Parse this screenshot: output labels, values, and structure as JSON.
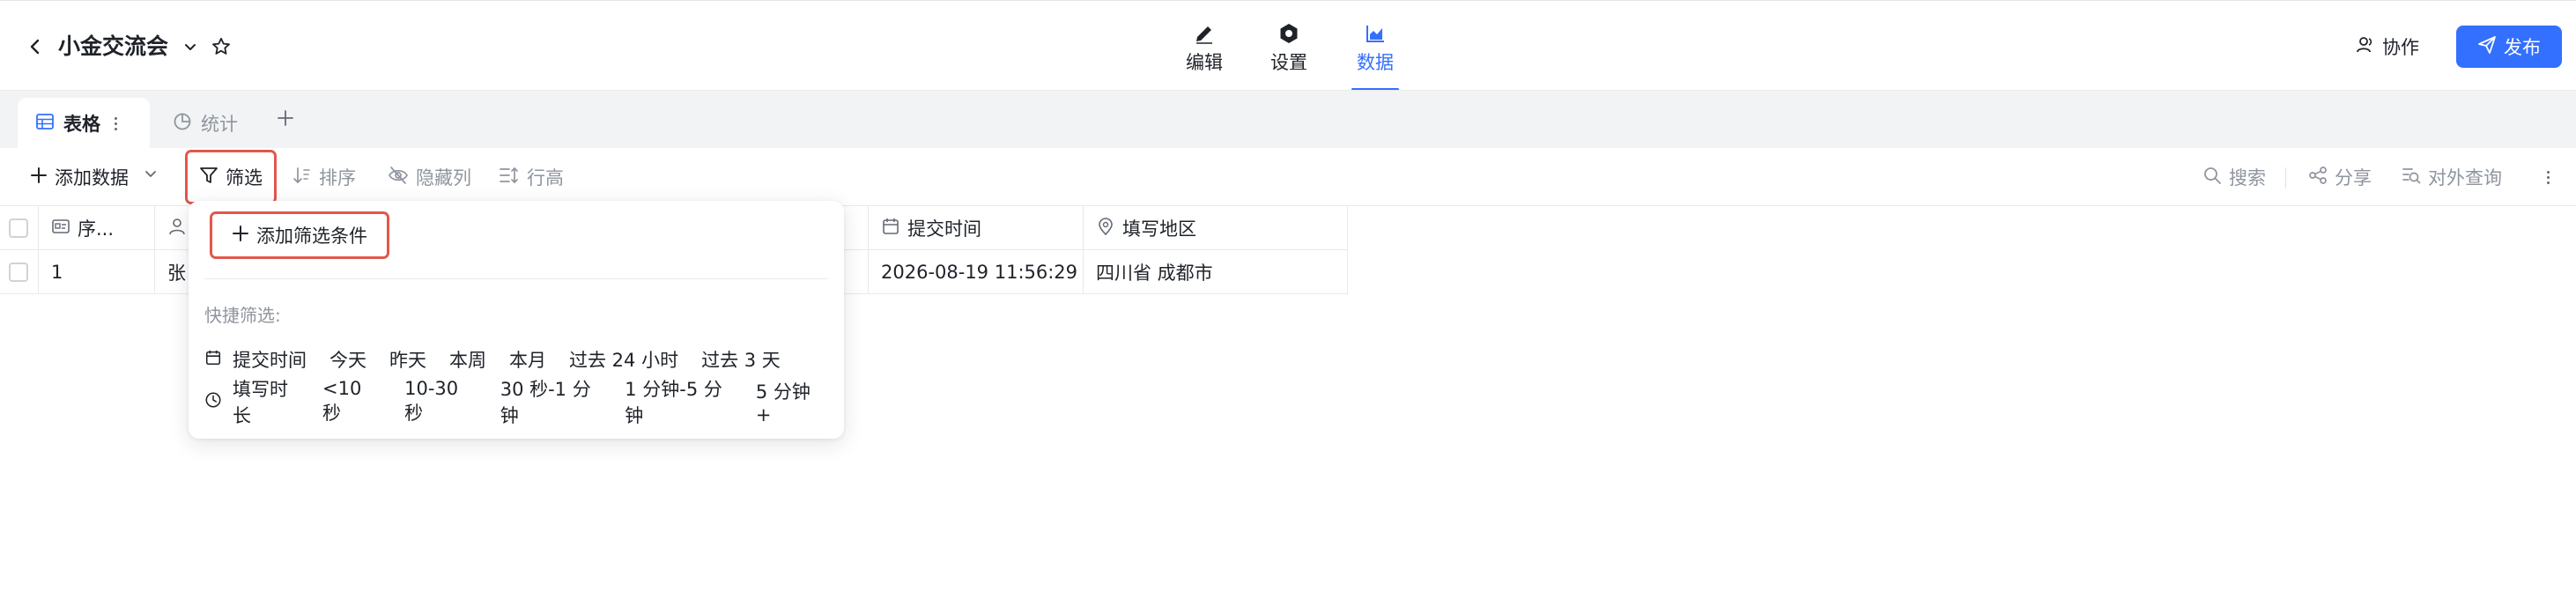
{
  "header": {
    "title": "小金交流会",
    "tabs": [
      {
        "label": "编辑",
        "icon": "pencil-icon"
      },
      {
        "label": "设置",
        "icon": "gear-icon"
      },
      {
        "label": "数据",
        "icon": "chart-icon",
        "active": true
      }
    ],
    "collab_label": "协作",
    "publish_label": "发布"
  },
  "views": {
    "tabs": [
      {
        "label": "表格",
        "icon": "table-icon",
        "active": true
      },
      {
        "label": "统计",
        "icon": "pie-chart-icon",
        "active": false
      }
    ]
  },
  "toolbar": {
    "add_data": "添加数据",
    "filter": "筛选",
    "sort": "排序",
    "hide_columns": "隐藏列",
    "row_height": "行高",
    "search": "搜索",
    "share": "分享",
    "public_query": "对外查询"
  },
  "table": {
    "columns": [
      "序...",
      "",
      "提交时间",
      "填写地区"
    ],
    "rows": [
      {
        "seq": "1",
        "user": "张",
        "submit_time": "2026-08-19 11:56:29",
        "region": "四川省 成都市"
      }
    ]
  },
  "filter_popover": {
    "add_condition": "添加筛选条件",
    "quick_label": "快捷筛选:",
    "quick_rows": [
      {
        "field": "提交时间",
        "icon": "calendar-icon",
        "options": [
          "今天",
          "昨天",
          "本周",
          "本月",
          "过去 24 小时",
          "过去 3 天"
        ]
      },
      {
        "field": "填写时长",
        "icon": "clock-icon",
        "options": [
          "<10 秒",
          "10-30 秒",
          "30 秒-1 分钟",
          "1 分钟-5 分钟",
          "5 分钟+"
        ]
      }
    ]
  },
  "colors": {
    "accent": "#3370ff",
    "highlight": "#e2574c"
  }
}
